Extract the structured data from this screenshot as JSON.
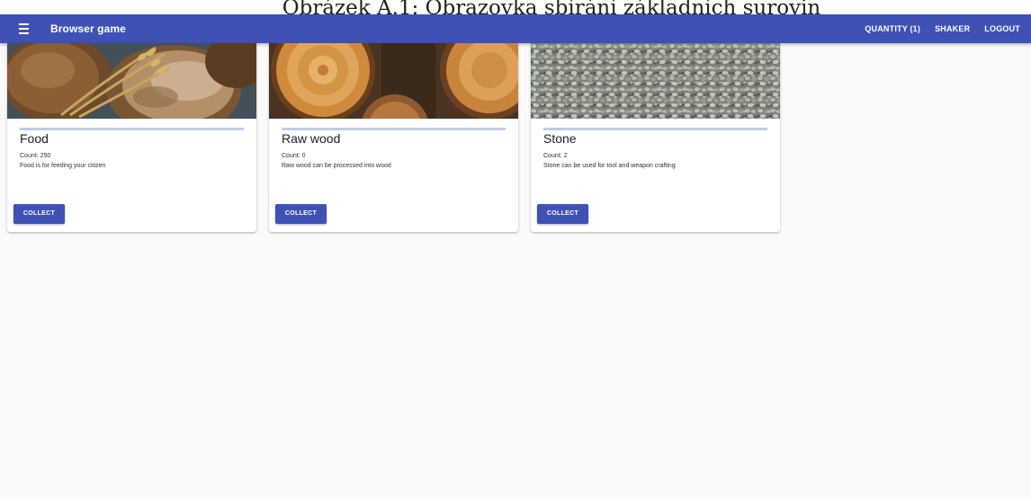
{
  "document": {
    "caption": "Obrázek A.1: Obrazovka sbírání základních surovin"
  },
  "appbar": {
    "title": "Browser game",
    "nav": [
      "QUANTITY (1)",
      "SHAKER",
      "LOGOUT"
    ],
    "color": "#3f51b5"
  },
  "cards": [
    {
      "title": "Food",
      "count": "Count: 250",
      "description": "Food is for feeding your citizen",
      "button": "COLLECT",
      "image": "bread-photo"
    },
    {
      "title": "Raw wood",
      "count": "Count: 0",
      "description": "Raw wood can be processed into wood",
      "button": "COLLECT",
      "image": "wood-logs-photo"
    },
    {
      "title": "Stone",
      "count": "Count: 2",
      "description": "Stone can be used for tool and weapon crafting",
      "button": "COLLECT",
      "image": "gravel-photo"
    }
  ]
}
